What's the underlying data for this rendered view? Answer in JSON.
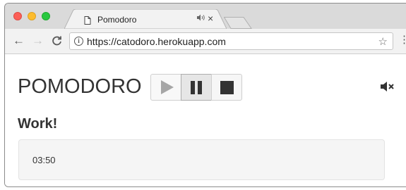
{
  "browser": {
    "tab": {
      "title": "Pomodoro",
      "audio_icon": "audio-icon",
      "close_label": "×"
    },
    "nav": {
      "back": "←",
      "forward": "→",
      "reload": "C"
    },
    "address_bar": {
      "url": "https://catodoro.herokuapp.com",
      "info_icon": "i",
      "star": "☆"
    },
    "menu_icon": "⋮"
  },
  "app": {
    "title": "POMODORO",
    "controls": [
      {
        "name": "play",
        "icon": "play-icon"
      },
      {
        "name": "pause",
        "icon": "pause-icon",
        "active": true
      },
      {
        "name": "stop",
        "icon": "stop-icon"
      }
    ],
    "mute_icon": "speaker-muted-icon",
    "status": "Work!",
    "timer": "03:50"
  },
  "colors": {
    "traffic_red": "#fc5f57",
    "traffic_yellow": "#fdbc2e",
    "traffic_green": "#28c840",
    "text_dark": "#333333"
  }
}
